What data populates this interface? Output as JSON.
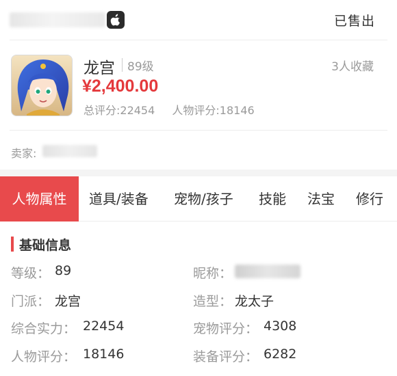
{
  "header": {
    "status": "已售出",
    "apple_icon": "apple-icon"
  },
  "role": {
    "name": "龙宫",
    "level": "89级",
    "favorites": "3人收藏",
    "price": "¥2,400.00",
    "total_score": "总评分:22454",
    "char_score": "人物评分:18146",
    "avatar_icon": "character-avatar"
  },
  "seller": {
    "label": "卖家:"
  },
  "tabs": [
    {
      "label": "人物属性",
      "active": true
    },
    {
      "label": "道具/装备",
      "active": false
    },
    {
      "label": "宠物/孩子",
      "active": false
    },
    {
      "label": "技能",
      "active": false
    },
    {
      "label": "法宝",
      "active": false
    },
    {
      "label": "修行",
      "active": false
    }
  ],
  "basic_info": {
    "title": "基础信息",
    "rows": [
      {
        "left_label": "等级：",
        "left_value": "89",
        "right_label": "昵称：",
        "right_value": ""
      },
      {
        "left_label": "门派：",
        "left_value": "龙宫",
        "right_label": "造型：",
        "right_value": "龙太子"
      },
      {
        "left_label": "综合实力：",
        "left_value": "22454",
        "right_label": "宠物评分：",
        "right_value": "4308"
      },
      {
        "left_label": "人物评分：",
        "left_value": "18146",
        "right_label": "装备评分：",
        "right_value": "6282"
      }
    ]
  },
  "colors": {
    "accent": "#e84a4c",
    "price": "#e4393c",
    "muted": "#9a9a9a"
  }
}
